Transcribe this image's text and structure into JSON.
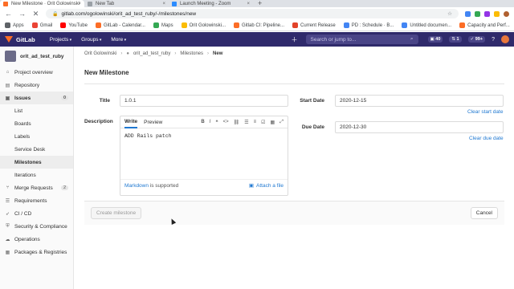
{
  "browser": {
    "tabs": [
      {
        "title": "New Milestone · Orit Golowinski",
        "color": "#fc6d26",
        "active": true
      },
      {
        "title": "New Tab",
        "color": "#9aa0a6",
        "active": false
      },
      {
        "title": "Launch Meeting - Zoom",
        "color": "#2d8cff",
        "active": false
      }
    ],
    "new_tab": "+",
    "url": "gitlab.com/ogolowinski/orit_ad_test_ruby/-/milestones/new",
    "bookmarks": [
      {
        "label": "Apps",
        "color": "#5f6368"
      },
      {
        "label": "Gmail",
        "color": "#ea4335"
      },
      {
        "label": "YouTube",
        "color": "#ff0000"
      },
      {
        "label": "GitLab - Calendar...",
        "color": "#fc6d26"
      },
      {
        "label": "Maps",
        "color": "#34a853"
      },
      {
        "label": "Orit Golowinski...",
        "color": "#fbbc04"
      },
      {
        "label": "Gitlab CI: Pipeline...",
        "color": "#fc6d26"
      },
      {
        "label": "Current Release",
        "color": "#e2432a"
      },
      {
        "label": "PD : Schedule · B...",
        "color": "#4285f4"
      },
      {
        "label": "Untitled documen...",
        "color": "#4285f4"
      },
      {
        "label": "Capacity and Perf...",
        "color": "#fc6d26"
      }
    ]
  },
  "gitlab_header": {
    "logo": "GitLab",
    "nav": [
      "Projects",
      "Groups",
      "More"
    ],
    "search_placeholder": "Search or jump to...",
    "badges": [
      "40",
      "1",
      "99+"
    ]
  },
  "sidebar": {
    "project_name": "orit_ad_test_ruby",
    "items": [
      {
        "label": "Project overview",
        "icon": "home-icon"
      },
      {
        "label": "Repository",
        "icon": "doc-icon"
      }
    ],
    "issues_label": "Issues",
    "issues_count": "0",
    "issue_subitems": [
      "List",
      "Boards",
      "Labels",
      "Service Desk",
      "Milestones",
      "Iterations"
    ],
    "merge_requests_label": "Merge Requests",
    "merge_requests_count": "2",
    "more_items": [
      "Requirements",
      "CI / CD",
      "Security & Compliance",
      "Operations",
      "Packages & Registries"
    ]
  },
  "breadcrumb": [
    "Orit Golowinski",
    "orit_ad_test_ruby",
    "Milestones",
    "New"
  ],
  "page_title": "New Milestone",
  "form": {
    "title_label": "Title",
    "title_value": "1.0.1",
    "description_label": "Description",
    "write_tab": "Write",
    "preview_tab": "Preview",
    "description_text": "ADD Rails patch",
    "markdown_link": "Markdown",
    "markdown_suffix": "is supported",
    "attach_label": "Attach a file",
    "start_date_label": "Start Date",
    "start_date_value": "2020-12-15",
    "clear_start": "Clear start date",
    "due_date_label": "Due Date",
    "due_date_value": "2020-12-30",
    "clear_due": "Clear due date"
  },
  "actions": {
    "create": "Create milestone",
    "cancel": "Cancel"
  }
}
